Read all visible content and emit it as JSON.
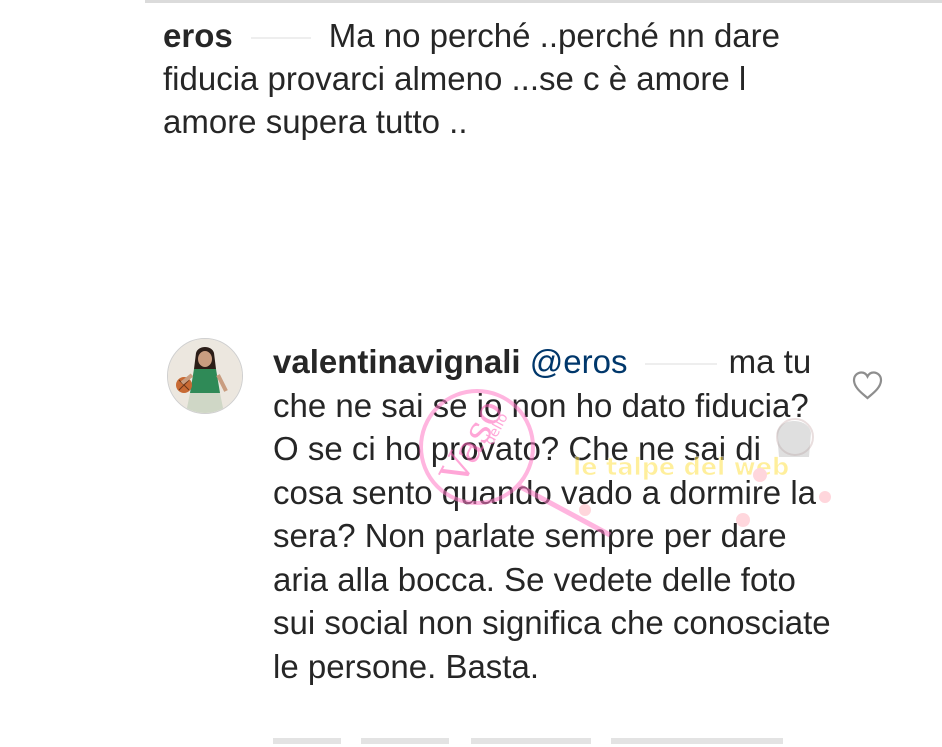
{
  "comment1": {
    "username": "eros",
    "text": "Ma no perché ..perché nn dare fiducia provarci almeno ...se c è amore l amore supera tutto .."
  },
  "comment2": {
    "username": "valentinavignali",
    "mention": "@eros",
    "text": "ma tu che ne sai se io non ho dato fiducia?  O se ci ho provato? Che ne sai di cosa sento quando vado a dormire la sera? Non parlate sempre per dare aria alla bocca. Se vedete delle foto sui social non significa che conosciate le persone. Basta."
  },
  "watermark": {
    "left": "Vaso",
    "small": "dello",
    "right": "le talpe del web"
  },
  "icons": [
    "heart-icon",
    "avatar"
  ]
}
